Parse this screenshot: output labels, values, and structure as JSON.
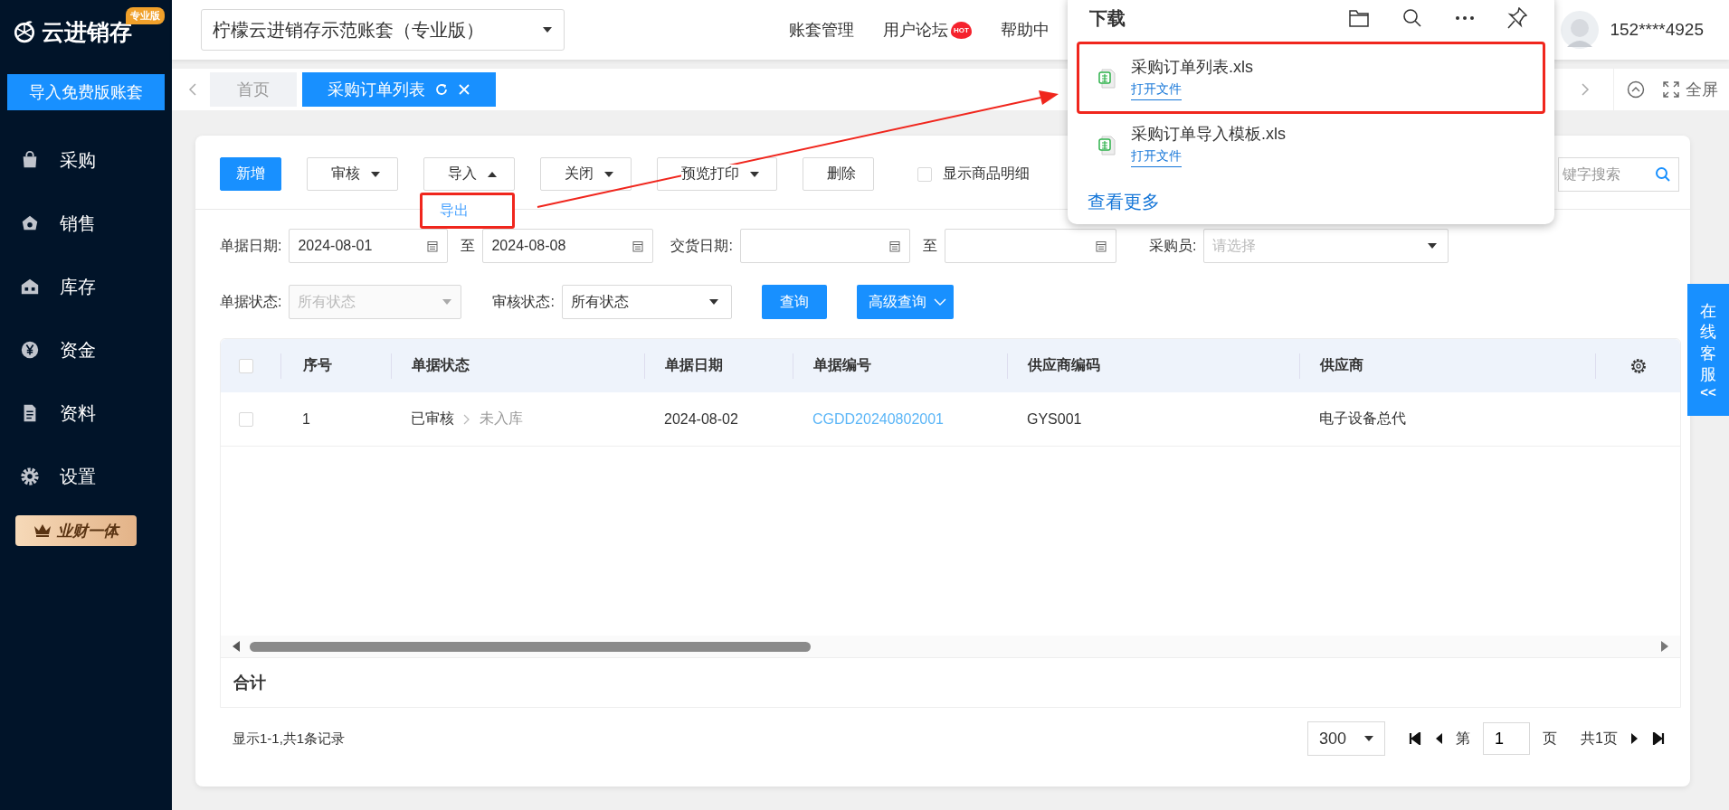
{
  "sidebar": {
    "logo": "云进销存",
    "edition_badge": "专业版",
    "import_button": "导入免费版账套",
    "items": [
      {
        "label": "采购",
        "kind": "bag"
      },
      {
        "label": "销售",
        "kind": "money"
      },
      {
        "label": "库存",
        "kind": "store"
      },
      {
        "label": "资金",
        "kind": "yen"
      },
      {
        "label": "资料",
        "kind": "doc"
      },
      {
        "label": "设置",
        "kind": "gear"
      }
    ],
    "promo_badge": "业财一体"
  },
  "header": {
    "account_select": "柠檬云进销存示范账套（专业版）",
    "nav": [
      {
        "label": "账套管理",
        "hot": false
      },
      {
        "label": "用户论坛",
        "hot": true
      },
      {
        "label": "帮助中",
        "hot": false
      }
    ],
    "hot_text": "HOT",
    "user": "152****4925"
  },
  "tabs": [
    {
      "label": "首页",
      "selected": false,
      "closable": false
    },
    {
      "label": "采购订单列表",
      "selected": true,
      "closable": true
    }
  ],
  "fullscreen": "全屏",
  "toolbar": {
    "buttons": [
      {
        "label": "新增",
        "kind": "primary"
      },
      {
        "label": "审核",
        "kind": "dropdown",
        "expanded": false
      },
      {
        "label": "导入",
        "kind": "dropdown",
        "expanded": true,
        "menu": [
          {
            "label": "导出",
            "highlighted": true
          }
        ]
      },
      {
        "label": "关闭",
        "kind": "dropdown",
        "expanded": false
      },
      {
        "label": "预览打印",
        "kind": "dropdown",
        "expanded": false
      },
      {
        "label": "删除",
        "kind": "plain"
      }
    ],
    "show_details": {
      "label": "显示商品明细",
      "checked": false
    },
    "search": {
      "placeholder": "键字搜索"
    }
  },
  "filters": {
    "row_1": [
      {
        "label": "单据日期:",
        "kind": "date",
        "value": "2024-08-01"
      },
      {
        "label": "至",
        "kind": "date",
        "value": "2024-08-08"
      },
      {
        "label": "交货日期:",
        "kind": "date"
      },
      {
        "label": "至",
        "kind": "date"
      },
      {
        "label": "采购员:",
        "kind": "select",
        "placeholder": "请选择",
        "disabled": false
      }
    ],
    "row_2": [
      {
        "label": "单据状态:",
        "placeholder": "所有状态",
        "disabled": true
      },
      {
        "label": "审核状态:",
        "value": "所有状态",
        "disabled": false
      }
    ],
    "buttons": [
      {
        "label": "查询",
        "kind": "primary"
      },
      {
        "label": "高级查询",
        "kind": "advanced"
      }
    ]
  },
  "table": {
    "select_all": false,
    "columns": [
      "序号",
      "单据状态",
      "单据日期",
      "单据编号",
      "供应商编码",
      "供应商"
    ],
    "rows": [
      {
        "checked": false,
        "index": "1",
        "status": "已审核",
        "stock_status": "未入库",
        "date": "2024-08-02",
        "number": "CGDD20240802001",
        "supplier_code": "GYS001",
        "supplier": "电子设备总代"
      }
    ],
    "total_label": "合计"
  },
  "pagination": {
    "summary": "显示1-1,共1条记录",
    "page_size": "300",
    "page_prefix": "第",
    "page": "1",
    "page_suffix": "页",
    "total_pages": "共1页"
  },
  "side_tab": {
    "label": "在线客服",
    "collapse": "<<"
  },
  "downloads": {
    "title": "下载",
    "items": [
      {
        "name": "采购订单列表.xls",
        "action": "打开文件",
        "highlighted": true
      },
      {
        "name": "采购订单导入模板.xls",
        "action": "打开文件",
        "highlighted": false
      }
    ],
    "more": "查看更多"
  }
}
